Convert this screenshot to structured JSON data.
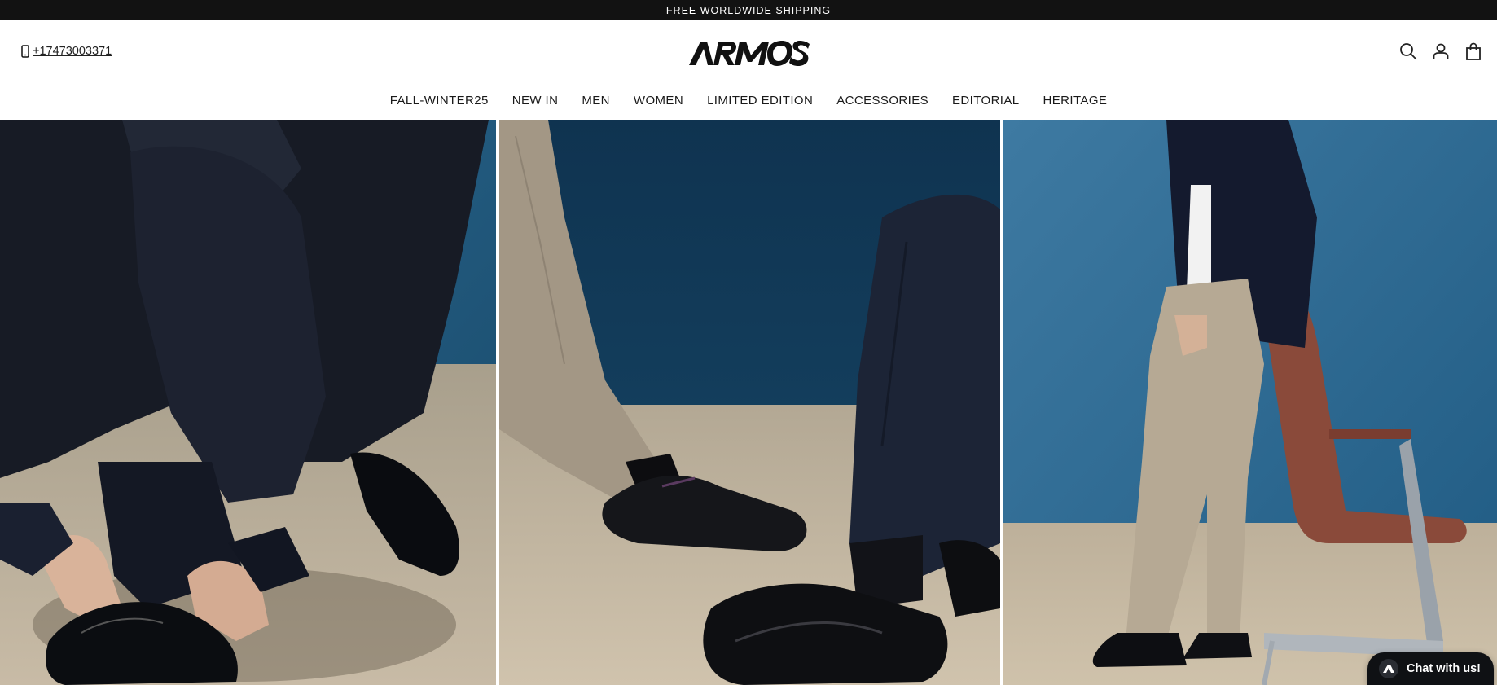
{
  "announcement": {
    "text": "FREE WORLDWIDE SHIPPING"
  },
  "header": {
    "phone": "+17473003371",
    "logo_text": "ARMOS",
    "icons": [
      "search-icon",
      "account-icon",
      "cart-icon"
    ]
  },
  "nav": {
    "items": [
      {
        "label": "FALL-WINTER25"
      },
      {
        "label": "NEW IN"
      },
      {
        "label": "MEN"
      },
      {
        "label": "WOMEN"
      },
      {
        "label": "LIMITED EDITION"
      },
      {
        "label": "ACCESSORIES"
      },
      {
        "label": "EDITORIAL"
      },
      {
        "label": "HERITAGE"
      }
    ]
  },
  "hero": {
    "panels": [
      {
        "subject": "man tying black brogue oxford shoes"
      },
      {
        "subject": "crossed legs with oxford and penny loafer shoes"
      },
      {
        "subject": "man in beige trousers leaning on leather chair"
      }
    ]
  },
  "chat": {
    "label": "Chat with us!"
  },
  "colors": {
    "announcement_bg": "#121212",
    "backdrop_blue": "#1f5a82",
    "floor_beige": "#c9bba6"
  }
}
